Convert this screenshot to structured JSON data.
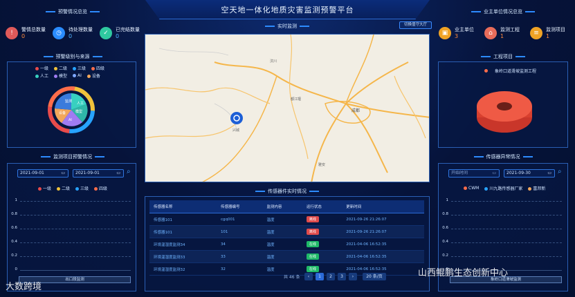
{
  "header": {
    "title": "空天地一体化地质灾害监测预警平台"
  },
  "warning_overview": {
    "title": "预警情况总览",
    "items": [
      {
        "label": "警情总数量",
        "value": "0",
        "icon": "alert-icon",
        "color": "#e05a5a"
      },
      {
        "label": "待处理数量",
        "value": "0",
        "icon": "pending-icon",
        "color": "#2a8cff"
      },
      {
        "label": "已完结数量",
        "value": "0",
        "icon": "check-icon",
        "color": "#2fc9a0"
      }
    ]
  },
  "owner_overview": {
    "title": "业主单位情况总览",
    "items": [
      {
        "label": "业主单位",
        "value": "3",
        "icon": "building-icon",
        "color": "#f0a325"
      },
      {
        "label": "监测工程",
        "value": "1",
        "icon": "project-icon",
        "color": "#e86c5a"
      },
      {
        "label": "监测项目",
        "value": "1",
        "icon": "list-icon",
        "color": "#f0a325"
      }
    ]
  },
  "level_source": {
    "title": "预警级别与来源",
    "levels": [
      {
        "name": "一级",
        "color": "#e84b4b"
      },
      {
        "name": "二级",
        "color": "#f0c23b"
      },
      {
        "name": "三级",
        "color": "#27a3ff"
      },
      {
        "name": "四级",
        "color": "#ff6d4a"
      }
    ],
    "sources": [
      {
        "name": "人工",
        "color": "#38d0c0"
      },
      {
        "name": "模型",
        "color": "#a07cf2"
      },
      {
        "name": "AI",
        "color": "#7ea8ff"
      },
      {
        "name": "设备",
        "color": "#f2a75b"
      }
    ],
    "inner_labels": [
      "监测",
      "人工",
      "模型",
      "AI",
      "设备"
    ]
  },
  "realtime": {
    "title": "实时监测",
    "switch_label": "切换值守大厅"
  },
  "project": {
    "title": "工程项目",
    "legend": "象岭口道滑坡监测工程"
  },
  "monitor_warning": {
    "title": "监测项目预警情况",
    "start_date": "2021-09-01",
    "end_date": "2021-09-01",
    "legend": [
      {
        "name": "一级",
        "color": "#e84b4b"
      },
      {
        "name": "二级",
        "color": "#f0c23b"
      },
      {
        "name": "三级",
        "color": "#27a3ff"
      },
      {
        "name": "四级",
        "color": "#ff6d4a"
      }
    ],
    "y_ticks": [
      "1",
      "0.8",
      "0.6",
      "0.4",
      "0.2",
      "0"
    ],
    "bottom_label": "出口段监测"
  },
  "sensor_realtime": {
    "title": "传感器件实时情况",
    "columns": [
      "传感器名称",
      "传感器编号",
      "监测内容",
      "运行状态",
      "更新时间"
    ],
    "rows": [
      {
        "name": "传感器101",
        "code": "cgq001",
        "content": "温度",
        "status": "离线",
        "status_color": "#e04b4b",
        "time": "2021-09-26 21:26:07"
      },
      {
        "name": "传感器101",
        "code": "101",
        "content": "温度",
        "status": "离线",
        "status_color": "#e04b4b",
        "time": "2021-09-26 21:26:07"
      },
      {
        "name": "环境温湿度监测34",
        "code": "34",
        "content": "温度",
        "status": "在线",
        "status_color": "#1fb968",
        "time": "2021-04-06 16:52:35"
      },
      {
        "name": "环境温湿度监测33",
        "code": "33",
        "content": "温度",
        "status": "在线",
        "status_color": "#1fb968",
        "time": "2021-04-06 16:52:35"
      },
      {
        "name": "环境温湿度监测32",
        "code": "32",
        "content": "温度",
        "status": "在线",
        "status_color": "#1fb968",
        "time": "2021-04-06 16:52:35"
      }
    ],
    "total": "共 46 条",
    "pages": [
      "1",
      "2",
      "3"
    ],
    "page_size": "20 条/页"
  },
  "sensor_anomaly": {
    "title": "传感器异常情况",
    "start_placeholder": "开始时间",
    "end_date": "2021-09-30",
    "legend": [
      {
        "name": "CWM",
        "color": "#ff6d4a"
      },
      {
        "name": "川九路传感器厂家",
        "color": "#27a3ff"
      },
      {
        "name": "富邦新",
        "color": "#f2a75b"
      }
    ],
    "y_ticks": [
      "1",
      "0.8",
      "0.6",
      "0.4",
      "0.2",
      "0"
    ],
    "bottom_label": "象岭口道滑坡监测"
  },
  "watermarks": {
    "left": "大数跨境",
    "right": "山西鲲鹏生态创新中心"
  },
  "map_labels": [
    "兴城",
    "成都",
    "都江堰",
    "汶川",
    "雅安"
  ]
}
